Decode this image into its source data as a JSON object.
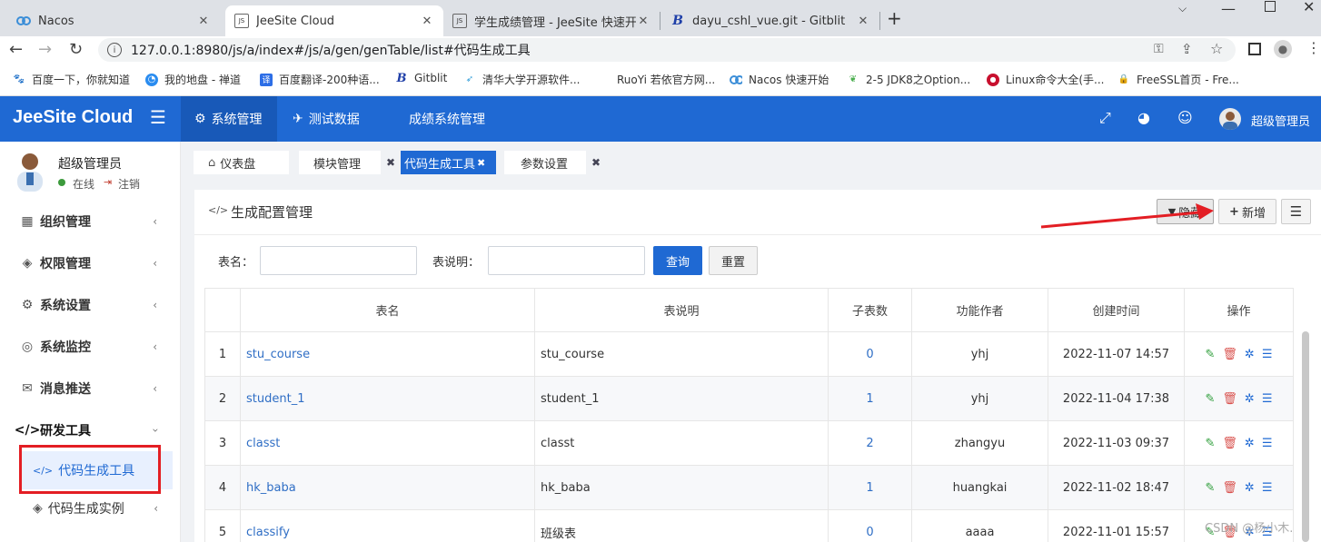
{
  "browser": {
    "tabs": [
      {
        "title": "Nacos",
        "icon": "nacos-icon"
      },
      {
        "title": "JeeSite Cloud",
        "icon": "js-icon",
        "active": true
      },
      {
        "title": "学生成绩管理 - JeeSite 快速开发",
        "icon": "js-icon"
      },
      {
        "title": "dayu_cshl_vue.git - Gitblit",
        "icon": "gitblit-icon"
      }
    ],
    "new_tab": "+",
    "url": "127.0.0.1:8980/js/a/index#/js/a/gen/genTable/list#代码生成工具",
    "bookmarks": [
      {
        "label": "百度一下，你就知道",
        "icon": "baidu-icon"
      },
      {
        "label": "我的地盘 - 禅道",
        "icon": "zentao-icon"
      },
      {
        "label": "百度翻译-200种语...",
        "icon": "translate-icon"
      },
      {
        "label": "Gitblit",
        "icon": "gitblit-icon"
      },
      {
        "label": "清华大学开源软件...",
        "icon": "tsinghua-icon"
      },
      {
        "label": "RuoYi 若依官方网...",
        "icon": "ruoyi-icon"
      },
      {
        "label": "Nacos 快速开始",
        "icon": "nacos-icon"
      },
      {
        "label": "2-5 JDK8之Option...",
        "icon": "jdk-icon"
      },
      {
        "label": "Linux命令大全(手...",
        "icon": "linux-icon"
      },
      {
        "label": "FreeSSL首页 - Fre...",
        "icon": "lock-icon"
      }
    ]
  },
  "app": {
    "brand": "JeeSite Cloud",
    "topnav": [
      {
        "label": "系统管理",
        "icon": "gear-icon",
        "active": true
      },
      {
        "label": "测试数据",
        "icon": "rocket-icon"
      },
      {
        "label": "成绩系统管理",
        "icon": ""
      }
    ],
    "user_name": "超级管理员"
  },
  "sidebar": {
    "user": {
      "name": "超级管理员",
      "status": "在线",
      "logout": "注销"
    },
    "items": [
      {
        "label": "组织管理",
        "icon": "grid-icon"
      },
      {
        "label": "权限管理",
        "icon": "layers-icon"
      },
      {
        "label": "系统设置",
        "icon": "gear-icon"
      },
      {
        "label": "系统监控",
        "icon": "monitor-icon"
      },
      {
        "label": "消息推送",
        "icon": "message-icon"
      },
      {
        "label": "研发工具",
        "icon": "code-icon",
        "expanded": true
      }
    ],
    "subitems": [
      {
        "label": "代码生成工具",
        "icon": "code-icon",
        "active": true
      },
      {
        "label": "代码生成实例",
        "icon": "layers-icon"
      }
    ]
  },
  "pagetabs": [
    {
      "label": "仪表盘",
      "icon": "home-icon"
    },
    {
      "label": "模块管理",
      "closable": true
    },
    {
      "label": "代码生成工具",
      "closable": true,
      "active": true
    },
    {
      "label": "参数设置",
      "closable": true
    }
  ],
  "card": {
    "title": "生成配置管理",
    "btn_hide": "隐藏",
    "btn_add": "新增",
    "search": {
      "table_name_label": "表名：",
      "table_comment_label": "表说明：",
      "query": "查询",
      "reset": "重置",
      "table_name_value": "",
      "table_comment_value": ""
    },
    "columns": [
      "",
      "表名",
      "表说明",
      "子表数",
      "功能作者",
      "创建时间",
      "操作"
    ],
    "rows": [
      {
        "no": "1",
        "name": "stu_course",
        "comment": "stu_course",
        "children": "0",
        "author": "yhj",
        "created": "2022-11-07 14:57"
      },
      {
        "no": "2",
        "name": "student_1",
        "comment": "student_1",
        "children": "1",
        "author": "yhj",
        "created": "2022-11-04 17:38"
      },
      {
        "no": "3",
        "name": "classt",
        "comment": "classt",
        "children": "2",
        "author": "zhangyu",
        "created": "2022-11-03 09:37"
      },
      {
        "no": "4",
        "name": "hk_baba",
        "comment": "hk_baba",
        "children": "1",
        "author": "huangkai",
        "created": "2022-11-02 18:47"
      },
      {
        "no": "5",
        "name": "classify",
        "comment": "班级表",
        "children": "0",
        "author": "aaaa",
        "created": "2022-11-01 15:57"
      }
    ]
  },
  "watermark": "CSDN @杨小木.",
  "colors": {
    "primary": "#1f69d3",
    "annotation": "#e31e24",
    "link": "#2f6ec5"
  }
}
